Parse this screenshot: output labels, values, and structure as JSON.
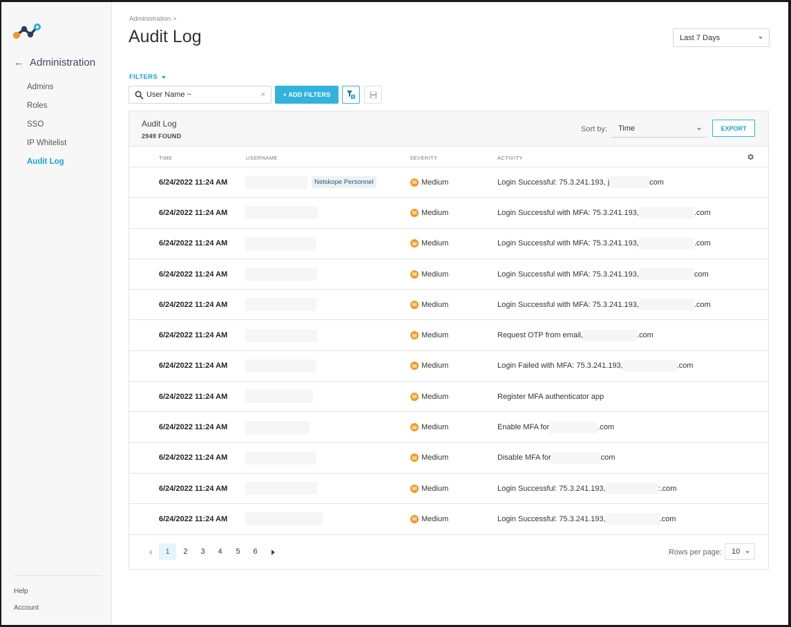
{
  "sidebar": {
    "back_label": "Administration",
    "items": [
      {
        "label": "Admins",
        "active": false
      },
      {
        "label": "Roles",
        "active": false
      },
      {
        "label": "SSO",
        "active": false
      },
      {
        "label": "IP Whitelist",
        "active": false
      },
      {
        "label": "Audit Log",
        "active": true
      }
    ],
    "footer": {
      "help": "Help",
      "account": "Account"
    }
  },
  "header": {
    "breadcrumb": "Administration >",
    "title": "Audit Log",
    "date_range": "Last 7 Days"
  },
  "filters": {
    "label": "FILTERS",
    "input_value": "User Name ~",
    "clear": "×",
    "add_button": "+ ADD FILTERS"
  },
  "log": {
    "title": "Audit Log",
    "count": "2949 FOUND",
    "sort_label": "Sort by:",
    "sort_value": "Time",
    "export": "EXPORT",
    "columns": {
      "time": "TIME",
      "username": "USERNAME",
      "severity": "SEVERITY",
      "activity": "ACTIVITY"
    },
    "rows": [
      {
        "time": "6/24/2022 11:24 AM",
        "badge": "Netskope Personnel",
        "severity": "Medium",
        "a1": "Login Successful: 75.3.241.193, j",
        "a2": "com"
      },
      {
        "time": "6/24/2022 11:24 AM",
        "badge": "",
        "severity": "Medium",
        "a1": "Login Successful with MFA: 75.3.241.193,",
        "a2": ".com"
      },
      {
        "time": "6/24/2022 11:24 AM",
        "badge": "",
        "severity": "Medium",
        "a1": "Login Successful with MFA: 75.3.241.193,",
        "a2": ".com"
      },
      {
        "time": "6/24/2022 11:24 AM",
        "badge": "",
        "severity": "Medium",
        "a1": "Login Successful with MFA: 75.3.241.193,",
        "a2": "com"
      },
      {
        "time": "6/24/2022 11:24 AM",
        "badge": "",
        "severity": "Medium",
        "a1": "Login Successful with MFA: 75.3.241.193,",
        "a2": ".com"
      },
      {
        "time": "6/24/2022 11:24 AM",
        "badge": "",
        "severity": "Medium",
        "a1": "Request OTP from email,",
        "a2": ".com"
      },
      {
        "time": "6/24/2022 11:24 AM",
        "badge": "",
        "severity": "Medium",
        "a1": "Login Failed with MFA: 75.3.241.193,",
        "a2": ".com"
      },
      {
        "time": "6/24/2022 11:24 AM",
        "badge": "",
        "severity": "Medium",
        "a1": "Register MFA authenticator app",
        "a2": ""
      },
      {
        "time": "6/24/2022 11:24 AM",
        "badge": "",
        "severity": "Medium",
        "a1": "Enable MFA for",
        "a2": ".com"
      },
      {
        "time": "6/24/2022 11:24 AM",
        "badge": "",
        "severity": "Medium",
        "a1": "Disable MFA for",
        "a2": "com"
      },
      {
        "time": "6/24/2022 11:24 AM",
        "badge": "",
        "severity": "Medium",
        "a1": "Login Successful: 75.3.241.193,",
        "a2": ":.com"
      },
      {
        "time": "6/24/2022 11:24 AM",
        "badge": "",
        "severity": "Medium",
        "a1": "Login Successful: 75.3.241.193,",
        "a2": ".com"
      }
    ]
  },
  "pagination": {
    "pages": [
      "1",
      "2",
      "3",
      "4",
      "5",
      "6"
    ],
    "current": "1",
    "rows_label": "Rows per page:",
    "rows_value": "10"
  },
  "colors": {
    "accent": "#32b2dd",
    "severity_medium": "#f59a23",
    "active_nav": "#1aa3d6"
  },
  "icons": {
    "severity": "M",
    "search": "search-icon",
    "gear": "gear-icon"
  }
}
